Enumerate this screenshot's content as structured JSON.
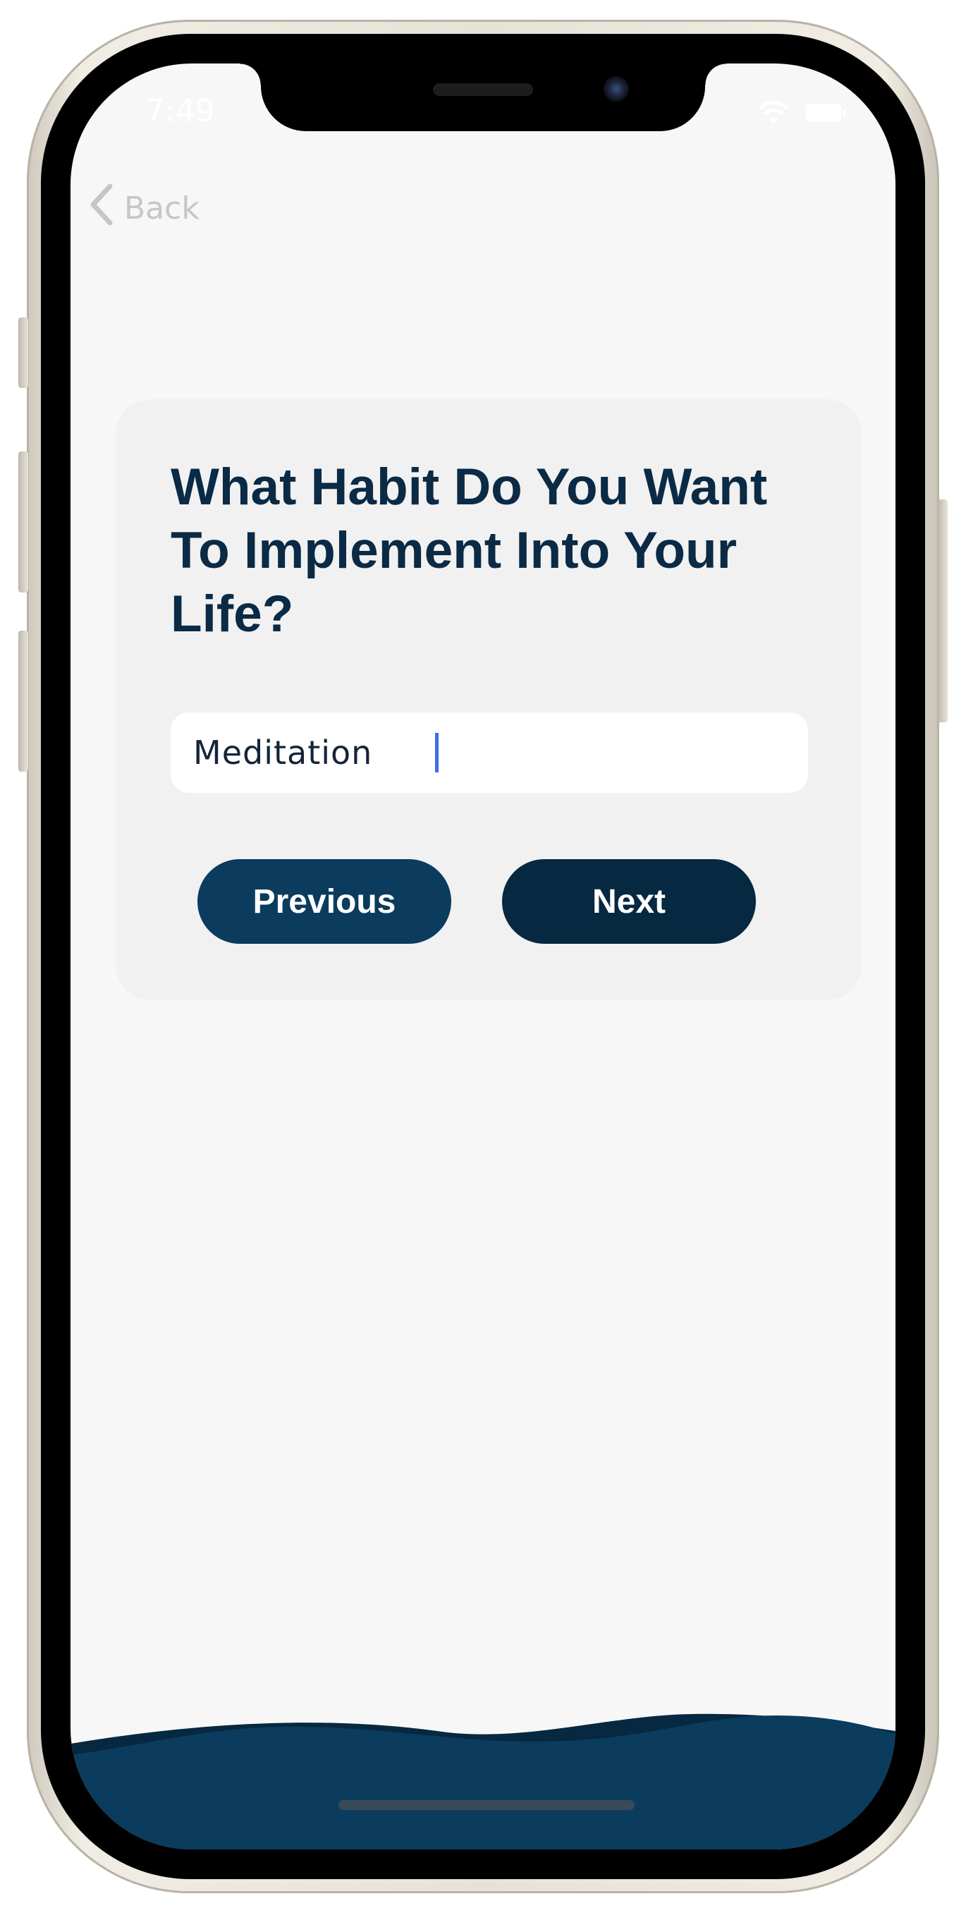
{
  "status_bar": {
    "time": "7:49"
  },
  "nav": {
    "back_label": "Back"
  },
  "card": {
    "question": "What Habit Do You Want To Implement Into Your Life?",
    "habit_input_value": "Meditation",
    "previous_label": "Previous",
    "next_label": "Next"
  },
  "colors": {
    "screen_background": "#f7f7f7",
    "card_background": "#f1f1f1",
    "heading_text": "#0a2a45",
    "previous_button": "#0b3c5e",
    "next_button": "#062840",
    "wave_front": "#0b3c5e",
    "wave_back": "#062840",
    "caret": "#3b6ee8"
  },
  "icons": {
    "back": "chevron-left-icon",
    "wifi": "wifi-icon",
    "battery": "battery-icon"
  }
}
